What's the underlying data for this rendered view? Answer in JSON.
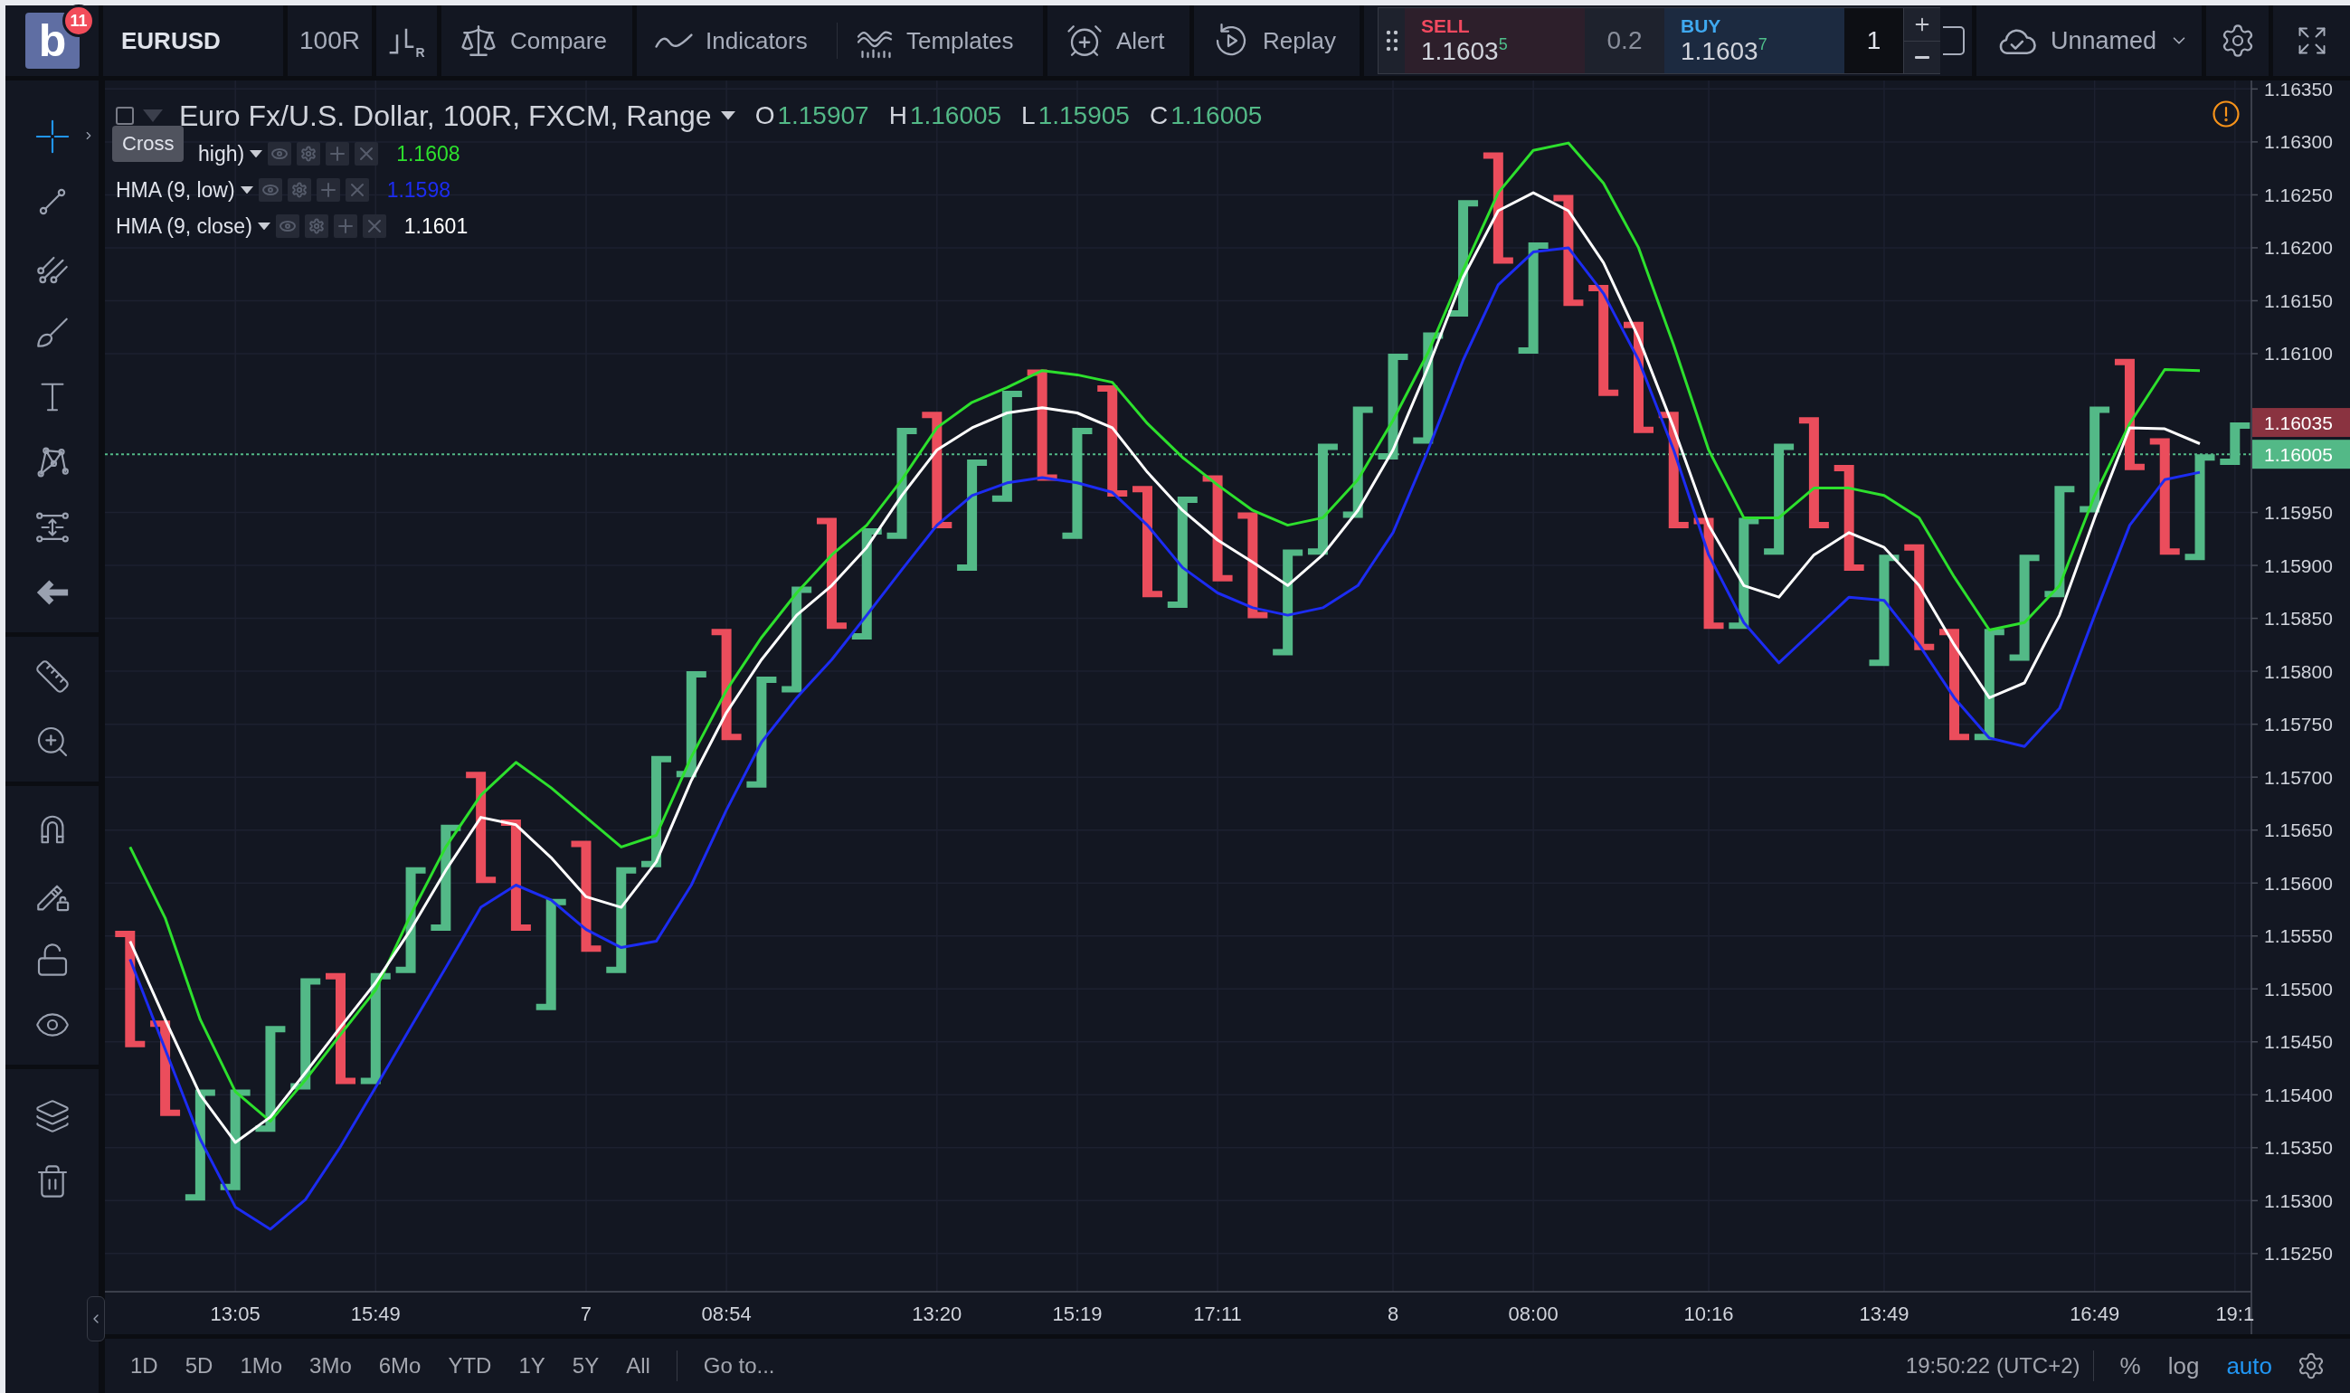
{
  "header": {
    "logo": {
      "letter": "b",
      "badge": "11"
    },
    "symbol": "EURUSD",
    "interval": "100R",
    "chart_type_mark": "R",
    "compare": "Compare",
    "indicators": "Indicators",
    "templates": "Templates",
    "alert": "Alert",
    "replay": "Replay",
    "trade": {
      "sell": {
        "label": "SELL",
        "price": "1.1603$^{5}$"
      },
      "spread": "0.2",
      "buy": {
        "label": "BUY",
        "price": "1.1603$^{7}$"
      },
      "quantity": "1"
    },
    "layout_name": "Unnamed"
  },
  "left_toolbar": {
    "groups": [
      [
        {
          "selected": true
        },
        {
          "selected": false
        },
        {
          "selected": false
        },
        {
          "selected": false
        },
        {
          "selected": false
        },
        {
          "selected": false
        },
        {
          "selected": false
        },
        {
          "selected": false
        }
      ],
      [
        {
          "selected": false
        },
        {
          "selected": false
        }
      ],
      [
        {
          "selected": false
        },
        {
          "selected": false
        },
        {
          "selected": false
        },
        {
          "selected": false
        }
      ],
      [
        {
          "selected": false
        },
        {
          "selected": false
        }
      ]
    ],
    "tooltip": "Cross"
  },
  "chart": {
    "title": "Euro Fx/U.S. Dollar, 100R, FXCM, Range",
    "ohlc": [
      {
        "label": "O",
        "value": "1.15907"
      },
      {
        "label": "H",
        "value": "1.16005"
      },
      {
        "label": "L",
        "value": "1.15905"
      },
      {
        "label": "C",
        "value": "1.16005"
      }
    ],
    "indicators": [
      {
        "name": "high)",
        "value": "1.1608",
        "color": "#2de02d"
      },
      {
        "name": "HMA (9, low)",
        "value": "1.1598",
        "color": "#1c2cf2"
      },
      {
        "name": "HMA (9, close)",
        "value": "1.1601",
        "color": "#ffffff"
      }
    ],
    "chart_data": {
      "type": "candlestick",
      "grid": true,
      "categories": [
        null,
        null,
        null,
        "13:05",
        null,
        null,
        null,
        "15:49",
        null,
        null,
        null,
        null,
        null,
        "7",
        null,
        null,
        null,
        "08:54",
        null,
        null,
        null,
        null,
        null,
        "13:20",
        null,
        null,
        null,
        "15:19",
        null,
        null,
        null,
        "17:11",
        null,
        null,
        null,
        null,
        "8",
        null,
        null,
        null,
        "08:00",
        null,
        null,
        null,
        null,
        "10:16",
        null,
        null,
        null,
        null,
        "13:49",
        null,
        null,
        null,
        null,
        null,
        "16:49",
        null,
        null,
        null,
        "19:1"
      ],
      "ohlc": [
        [
          1.15555,
          1.15555,
          1.15445,
          1.15445
        ],
        [
          1.1547,
          1.1547,
          1.1538,
          1.1538
        ],
        [
          1.153,
          1.15405,
          1.153,
          1.15405
        ],
        [
          1.1531,
          1.15405,
          1.1531,
          1.15405
        ],
        [
          1.15365,
          1.15465,
          1.15365,
          1.15465
        ],
        [
          1.15405,
          1.1551,
          1.15405,
          1.1551
        ],
        [
          1.15515,
          1.15515,
          1.1541,
          1.1541
        ],
        [
          1.1541,
          1.15515,
          1.1541,
          1.15515
        ],
        [
          1.15515,
          1.15615,
          1.15515,
          1.15615
        ],
        [
          1.15555,
          1.15655,
          1.15555,
          1.15655
        ],
        [
          1.15705,
          1.15705,
          1.156,
          1.156
        ],
        [
          1.1566,
          1.1566,
          1.15555,
          1.15555
        ],
        [
          1.1548,
          1.15585,
          1.1548,
          1.15585
        ],
        [
          1.1564,
          1.1564,
          1.15535,
          1.15535
        ],
        [
          1.15515,
          1.15615,
          1.15515,
          1.15615
        ],
        [
          1.15615,
          1.1572,
          1.15615,
          1.1572
        ],
        [
          1.157,
          1.158,
          1.157,
          1.158
        ],
        [
          1.1584,
          1.1584,
          1.15735,
          1.15735
        ],
        [
          1.1569,
          1.15795,
          1.1569,
          1.15795
        ],
        [
          1.1578,
          1.1588,
          1.1578,
          1.1588
        ],
        [
          1.15945,
          1.15945,
          1.1584,
          1.1584
        ],
        [
          1.1583,
          1.15935,
          1.1583,
          1.15935
        ],
        [
          1.15925,
          1.1603,
          1.15925,
          1.1603
        ],
        [
          1.16045,
          1.16045,
          1.15935,
          1.15935
        ],
        [
          1.15895,
          1.16,
          1.15895,
          1.16
        ],
        [
          1.1596,
          1.16065,
          1.1596,
          1.16065
        ],
        [
          1.16085,
          1.16085,
          1.1598,
          1.1598
        ],
        [
          1.15925,
          1.1603,
          1.15925,
          1.1603
        ],
        [
          1.1607,
          1.1607,
          1.15965,
          1.15965
        ],
        [
          1.15975,
          1.15975,
          1.1587,
          1.1587
        ],
        [
          1.1586,
          1.15965,
          1.1586,
          1.15965
        ],
        [
          1.15985,
          1.15985,
          1.15885,
          1.15885
        ],
        [
          1.1595,
          1.1595,
          1.1585,
          1.1585
        ],
        [
          1.15815,
          1.15915,
          1.15815,
          1.15915
        ],
        [
          1.1591,
          1.16015,
          1.1591,
          1.16015
        ],
        [
          1.15945,
          1.1605,
          1.15945,
          1.1605
        ],
        [
          1.16,
          1.161,
          1.16,
          1.161
        ],
        [
          1.16015,
          1.1612,
          1.16015,
          1.1612
        ],
        [
          1.16135,
          1.16245,
          1.16135,
          1.16245
        ],
        [
          1.1629,
          1.1629,
          1.16185,
          1.16185
        ],
        [
          1.161,
          1.16205,
          1.161,
          1.16205
        ],
        [
          1.1625,
          1.1625,
          1.16145,
          1.16145
        ],
        [
          1.16165,
          1.16165,
          1.1606,
          1.1606
        ],
        [
          1.1613,
          1.1613,
          1.16025,
          1.16025
        ],
        [
          1.16045,
          1.16045,
          1.15935,
          1.15935
        ],
        [
          1.15945,
          1.15945,
          1.1584,
          1.1584
        ],
        [
          1.1584,
          1.15945,
          1.1584,
          1.15945
        ],
        [
          1.1591,
          1.16015,
          1.1591,
          1.16015
        ],
        [
          1.1604,
          1.1604,
          1.15935,
          1.15935
        ],
        [
          1.15995,
          1.15995,
          1.15895,
          1.15895
        ],
        [
          1.15805,
          1.1591,
          1.15805,
          1.1591
        ],
        [
          1.1592,
          1.1592,
          1.1582,
          1.1582
        ],
        [
          1.1584,
          1.1584,
          1.15735,
          1.15735
        ],
        [
          1.15735,
          1.1584,
          1.15735,
          1.1584
        ],
        [
          1.1581,
          1.1591,
          1.1581,
          1.1591
        ],
        [
          1.1587,
          1.15975,
          1.1587,
          1.15975
        ],
        [
          1.1595,
          1.1605,
          1.1595,
          1.1605
        ],
        [
          1.16095,
          1.16095,
          1.1599,
          1.1599
        ],
        [
          1.1602,
          1.1602,
          1.1591,
          1.1591
        ],
        [
          1.15907,
          1.16005,
          1.15905,
          1.16005
        ],
        [
          1.15995,
          1.16035,
          1.15995,
          1.16035
        ]
      ],
      "series": [
        {
          "type": "line",
          "color": "#2de02d",
          "values": [
            1.15634,
            1.15567,
            1.15471,
            1.15403,
            1.15375,
            1.15414,
            1.15457,
            1.15499,
            1.1557,
            1.15634,
            1.15683,
            1.15714,
            1.1569,
            1.15662,
            1.15634,
            1.15645,
            1.15719,
            1.15782,
            1.15832,
            1.15874,
            1.1591,
            1.15938,
            1.15981,
            1.1603,
            1.16054,
            1.16068,
            1.16084,
            1.1608,
            1.16073,
            1.16034,
            1.16002,
            1.15976,
            1.15952,
            1.15938,
            1.15945,
            1.15981,
            1.16037,
            1.16101,
            1.16179,
            1.16252,
            1.16292,
            1.16299,
            1.16261,
            1.162,
            1.16108,
            1.16009,
            1.15945,
            1.15945,
            1.15973,
            1.15973,
            1.15966,
            1.15945,
            1.15889,
            1.15839,
            1.15846,
            1.15881,
            1.15966,
            1.16034,
            1.16085,
            1.16084,
            null
          ]
        },
        {
          "type": "line",
          "color": "#1c2cf2",
          "values": [
            1.15528,
            1.15443,
            1.15358,
            1.15294,
            1.15273,
            1.15301,
            1.15351,
            1.15407,
            1.15464,
            1.1552,
            1.15577,
            1.15598,
            1.15584,
            1.15556,
            1.15539,
            1.15545,
            1.15598,
            1.15669,
            1.15733,
            1.15775,
            1.15811,
            1.15853,
            1.15896,
            1.15938,
            1.15966,
            1.15978,
            1.15983,
            1.15978,
            1.15969,
            1.15938,
            1.15898,
            1.15874,
            1.1586,
            1.15853,
            1.1586,
            1.15881,
            1.15931,
            1.16009,
            1.16094,
            1.16165,
            1.16196,
            1.162,
            1.16157,
            1.16094,
            1.16009,
            1.1591,
            1.15846,
            1.15808,
            1.15839,
            1.1587,
            1.15867,
            1.15825,
            1.15775,
            1.15737,
            1.15729,
            1.15765,
            1.15853,
            1.15938,
            1.15981,
            1.15988,
            null
          ]
        },
        {
          "type": "line",
          "color": "#ffffff",
          "values": [
            1.15545,
            1.15471,
            1.154,
            1.15355,
            1.15379,
            1.15421,
            1.15464,
            1.15506,
            1.15556,
            1.15612,
            1.15662,
            1.15655,
            1.15624,
            1.15587,
            1.15577,
            1.1562,
            1.15697,
            1.15761,
            1.15811,
            1.15853,
            1.15881,
            1.15917,
            1.15966,
            1.16009,
            1.1603,
            1.16044,
            1.16049,
            1.16044,
            1.1603,
            1.15988,
            1.15952,
            1.15924,
            1.15903,
            1.15881,
            1.1591,
            1.15952,
            1.16009,
            1.16087,
            1.16172,
            1.16235,
            1.16252,
            1.16235,
            1.16186,
            1.16115,
            1.1603,
            1.15938,
            1.15881,
            1.1587,
            1.1591,
            1.15931,
            1.15917,
            1.15881,
            1.15825,
            1.15775,
            1.15789,
            1.15853,
            1.15945,
            1.1603,
            1.16029,
            1.16015,
            null
          ]
        }
      ],
      "ylim": [
        1.15214,
        1.16358
      ],
      "yticks": [
        {
          "value": 1.1525,
          "label": "1.15250"
        },
        {
          "value": 1.153,
          "label": "1.15300"
        },
        {
          "value": 1.1535,
          "label": "1.15350"
        },
        {
          "value": 1.154,
          "label": "1.15400"
        },
        {
          "value": 1.1545,
          "label": "1.15450"
        },
        {
          "value": 1.155,
          "label": "1.15500"
        },
        {
          "value": 1.1555,
          "label": "1.15550"
        },
        {
          "value": 1.156,
          "label": "1.15600"
        },
        {
          "value": 1.1565,
          "label": "1.15650"
        },
        {
          "value": 1.157,
          "label": "1.15700"
        },
        {
          "value": 1.1575,
          "label": "1.15750"
        },
        {
          "value": 1.158,
          "label": "1.15800"
        },
        {
          "value": 1.1585,
          "label": "1.15850"
        },
        {
          "value": 1.159,
          "label": "1.15900"
        },
        {
          "value": 1.1595,
          "label": "1.15950"
        },
        {
          "value": 1.161,
          "label": "1.16100"
        },
        {
          "value": 1.1615,
          "label": "1.16150"
        },
        {
          "value": 1.162,
          "label": "1.16200"
        },
        {
          "value": 1.1625,
          "label": "1.16250"
        },
        {
          "value": 1.163,
          "label": "1.16300"
        },
        {
          "value": 1.1635,
          "label": "1.16350"
        }
      ],
      "ref_lines": [
        {
          "axis": "y",
          "value": 1.16005,
          "label": "1.16005",
          "color": "#53b987",
          "line_style": "dotted"
        }
      ],
      "annotations": [
        "1.16035"
      ]
    }
  },
  "bottom_bar": {
    "ranges": [
      "1D",
      "5D",
      "1Mo",
      "3Mo",
      "6Mo",
      "YTD",
      "1Y",
      "5Y",
      "All"
    ],
    "goto": "Go to...",
    "clock": "19:50:22 (UTC+2)",
    "scales": [
      {
        "label": "%",
        "selected": false
      },
      {
        "label": "log",
        "selected": false
      },
      {
        "label": "auto",
        "selected": true
      }
    ]
  }
}
